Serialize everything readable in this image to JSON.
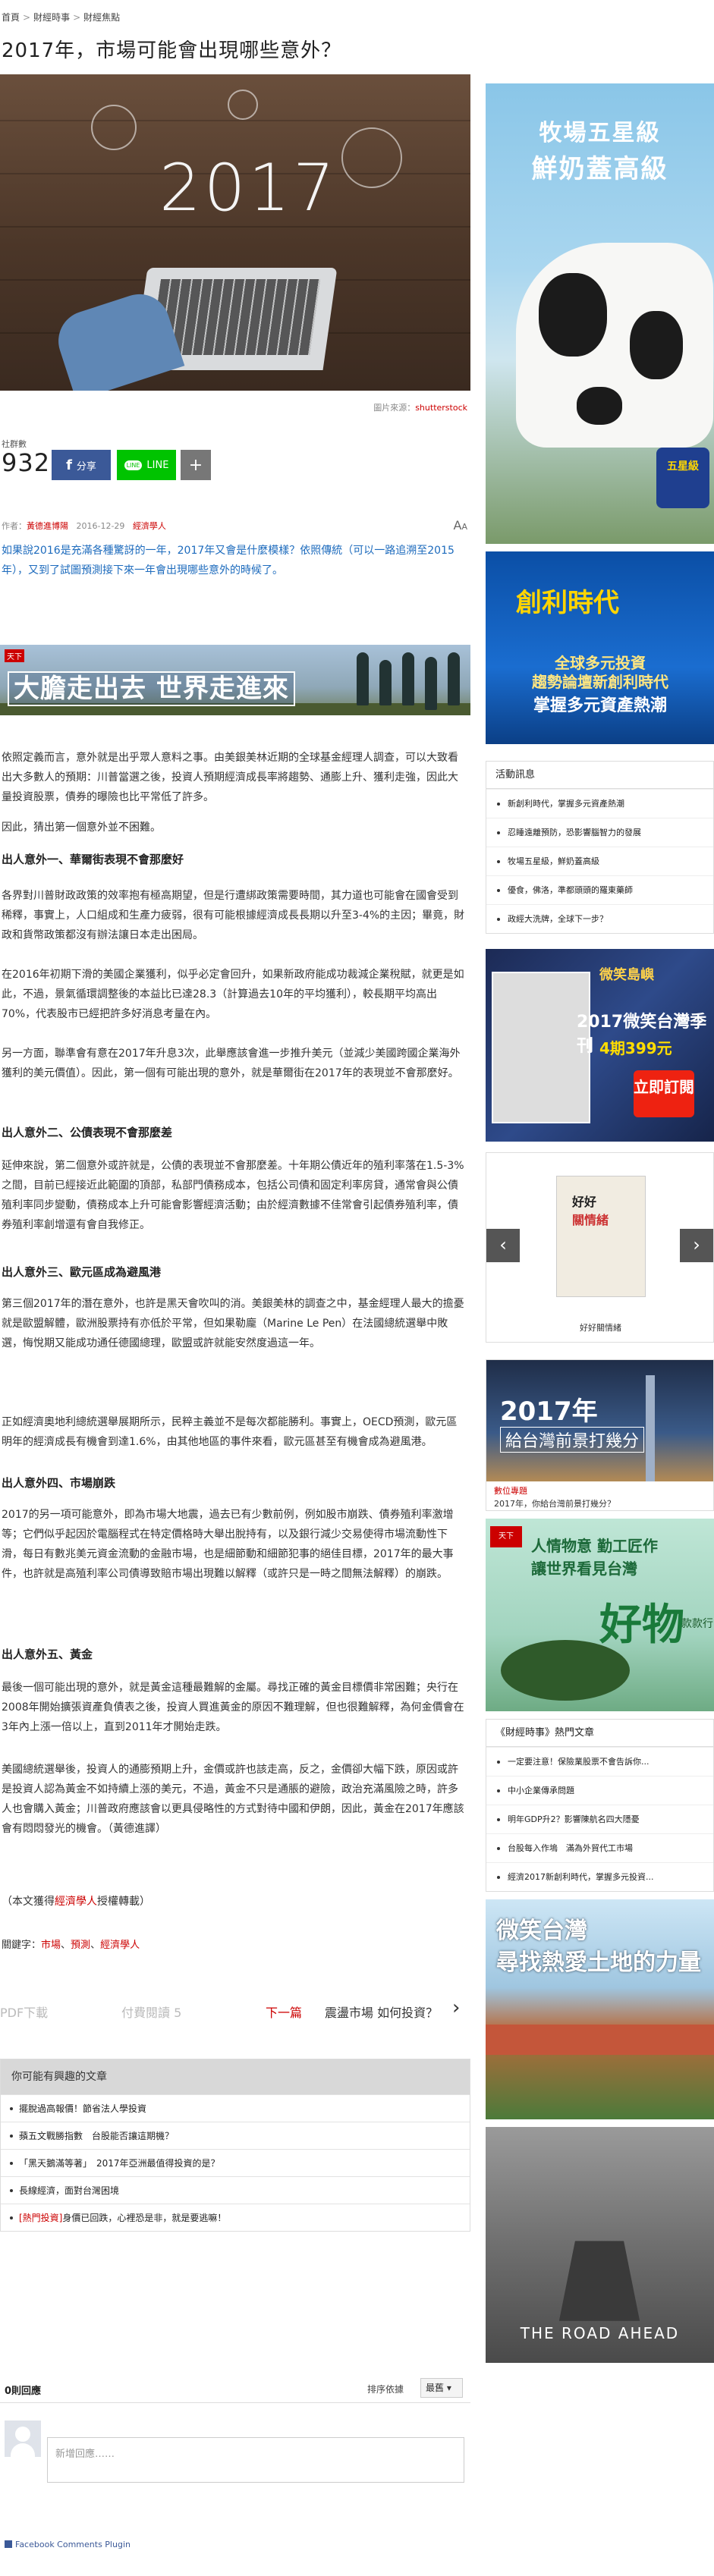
{
  "breadcrumb": {
    "home": "首頁",
    "section": "財經時事",
    "sub": "財經焦點"
  },
  "article": {
    "title": "2017年，市場可能會出現哪些意外？",
    "hero_year": "2017",
    "credit_label": "圖片來源：",
    "credit_source": "shutterstock",
    "share_count_label": "社群數",
    "share_count": "932",
    "fb_label": "分享",
    "line_label": "LINE",
    "plus_label": "+",
    "author_label": "作者：",
    "author": "黃德進博陽",
    "date": "2016-12-29",
    "category": "經濟學人",
    "font_size_big": "A",
    "font_size_small": "A",
    "lead": "如果說2016是充滿各種驚訝的一年，2017年又會是什麼模樣？依照傳統（可以一路追溯至2015年），又到了試圖預測接下來一年會出現哪些意外的時候了。",
    "banner_badge": "天下",
    "banner_text": "大膽走出去 世界走進來",
    "paragraphs": [
      "依照定義而言，意外就是出乎眾人意料之事。由美銀美林近期的全球基金經理人調查，可以大致看出大多數人的預期：川普當選之後，投資人預期經濟成長率將趨勢、通膨上升、獲利走強，因此大量投資股票，債券的曝險也比平常低了許多。",
      "因此，猜出第一個意外並不困難。"
    ],
    "sections": [
      {
        "heading": "出人意外一、華爾街表現不會那麼好",
        "paragraphs": [
          "各界對川普財政政策的效率抱有極高期望，但是行遭綁政策需要時間，其力道也可能會在國會受到稀釋，事實上，人口組成和生產力疲弱，很有可能根據經濟成長長期以升至3-4%的主因；畢竟，財政和貨幣政策都沒有辦法讓日本走出困局。",
          "在2016年初期下滑的美國企業獲利，似乎必定會回升，如果新政府能成功裁減企業稅賦，就更是如此，不過，景氣循環調整後的本益比已達28.3（計算過去10年的平均獲利），較長期平均高出70%，代表股市已經把許多好消息考量在內。",
          "另一方面，聯準會有意在2017年升息3次，此舉應該會進一步推升美元（並減少美國跨國企業海外獲利的美元價值）。因此，第一個有可能出現的意外，就是華爾街在2017年的表現並不會那麼好。"
        ]
      },
      {
        "heading": "出人意外二、公債表現不會那麼差",
        "paragraphs": [
          "延伸來說，第二個意外或許就是，公債的表現並不會那麼差。十年期公債近年的殖利率落在1.5-3%之間，目前已經接近此範圍的頂部，私部門債務成本，包括公司債和固定利率房貸，通常會與公債殖利率同步變動，債務成本上升可能會影響經濟活動；由於經濟數據不佳常會引起債券殖利率，債券殖利率創增還有會自我修正。"
        ]
      },
      {
        "heading": "出人意外三、歐元區成為避風港",
        "paragraphs": [
          "第三個2017年的潛在意外，也許是黑天會吹叫的消。美銀美林的調查之中，基金經理人最大的擔憂就是歐盟解體，歐洲股票持有亦低於平常，但如果勒龐（Marine Le Pen）在法國總統選舉中敗選，悔悅期又能成功通任德國總理，歐盟或許就能安然度過這一年。",
          "正如經濟奧地利總統選舉展期所示，民粹主義並不是每次都能勝利。事實上，OECD預測，歐元區明年的經濟成長有機會到達1.6%，由其他地區的事件來看，歐元區甚至有機會成為避風港。"
        ]
      },
      {
        "heading": "出人意外四、市場崩跌",
        "paragraphs": [
          "2017的另一項可能意外，即為市場大地震，過去已有少數前例，例如股市崩跌、債券殖利率激增等；它們似乎起因於電腦程式在特定價格時大舉出脫持有，以及銀行減少交易使得市場流動性下滑，每日有數兆美元資金流動的金融市場，也是細節動和細節犯事的絕佳目標，2017年的最大事件，也許就是高殖利率公司債導致賠市場出現難以解釋（或許只是一時之間無法解釋）的崩跌。"
        ]
      },
      {
        "heading": "出人意外五、黃金",
        "paragraphs": [
          "最後一個可能出現的意外，就是黃金這種最難解的金屬。尋找正確的黃金目標價非常困難；央行在2008年開始擴張資產負債表之後，投資人買進黃金的原因不難理解，但也很難解釋，為何金價會在3年內上漲一倍以上，直到2011年才開始走跌。",
          "美國總統選舉後，投資人的通膨預期上升，金價或許也該走高，反之，金價卻大幅下跌，原因或許是投資人認為黃金不如持續上漲的美元，不過，黃金不只是通脹的避險，政治充滿風險之時，許多人也會購入黃金；川普政府應該會以更具侵略性的方式對待中國和伊朗，因此，黃金在2017年應該會有悶悶發光的機會。（黃德進譯）"
        ]
      }
    ],
    "source_prefix": "（本文獲得",
    "source_name": "經濟學人",
    "source_suffix": "授權轉載）",
    "keywords_label": "關鍵字：",
    "keywords": [
      "市場",
      "預測",
      "經濟學人"
    ]
  },
  "pager": {
    "pdf": "PDF下載",
    "pay": "付費閱讀 5",
    "next": "下一篇",
    "next_title": "震盪市場 如何投資？",
    "arrow": "›"
  },
  "related": {
    "heading": "你可能有興趣的文章",
    "items": [
      {
        "tag": "",
        "text": "擺脫過高報價！節省法人學投資"
      },
      {
        "tag": "",
        "text": "蘋五文戰勝指數　台股能否讓這期機？"
      },
      {
        "tag": "",
        "text": "「黑天鵝滿等著」　2017年亞洲最值得投資的是？"
      },
      {
        "tag": "",
        "text": "長線經濟，面對台灣困境"
      },
      {
        "tag": "[熱門投資]",
        "text": "身價已回跌，心裡恐是非，就是要逃嘛！"
      }
    ]
  },
  "comments": {
    "count": "0則回應",
    "sort_label": "排序依據",
    "sort_value": "最舊",
    "placeholder": "新增回應……",
    "plugin": "Facebook Comments Plugin"
  },
  "sidebar": {
    "ad1": {
      "line1": "牧場五星級",
      "line2": "鮮奶蓋高級",
      "logo": "五星級"
    },
    "ad2": {
      "title": "創利時代",
      "line1": "全球多元投資",
      "line2": "趨勢論壇新創利時代",
      "line3": "掌握多元資產熱潮"
    },
    "events": {
      "heading": "活動訊息",
      "items": [
        "新創利時代，掌握多元資產熱潮",
        "忍睡遠離預防，恐影響腦智力的發展",
        "牧場五星級，鮮奶蓋高級",
        "優食，佛洛，準都頭頭的羅東藥師",
        "政經大洗牌，全球下一步？"
      ]
    },
    "ad3": {
      "line1": "微笑島嶼",
      "line2": "2017微笑台灣季刊",
      "line3": "4期399元",
      "cta": "立即訂閱"
    },
    "book": {
      "title1": "好好",
      "title2": "關情緒",
      "caption": "好好關情緒",
      "prev": "‹",
      "next": "›"
    },
    "ad4": {
      "year": "2017年",
      "sub": "給台灣前景打幾分",
      "tag": "數位專題",
      "caption": "2017年，你給台灣前景打幾分？"
    },
    "ad5": {
      "logo": "天下",
      "line1": "人情物意 勤工匠作",
      "line2": "讓世界看見台灣",
      "big": "好物",
      "small": "款款行"
    },
    "popular": {
      "heading": "《財經時事》熱門文章",
      "items": [
        "一定要注意！保險業股票不會告訴你...",
        "中小企業傳承問題",
        "明年GDP升2？影響陳航名四大隱憂",
        "台股每入作塢　滿為外貿代工市場",
        "經濟2017新創利時代，掌握多元投資..."
      ]
    },
    "ad6": {
      "line1": "微笑台灣",
      "line2": "尋找熱愛土地的力量"
    },
    "ad7": {
      "title": "THE ROAD AHEAD"
    }
  }
}
